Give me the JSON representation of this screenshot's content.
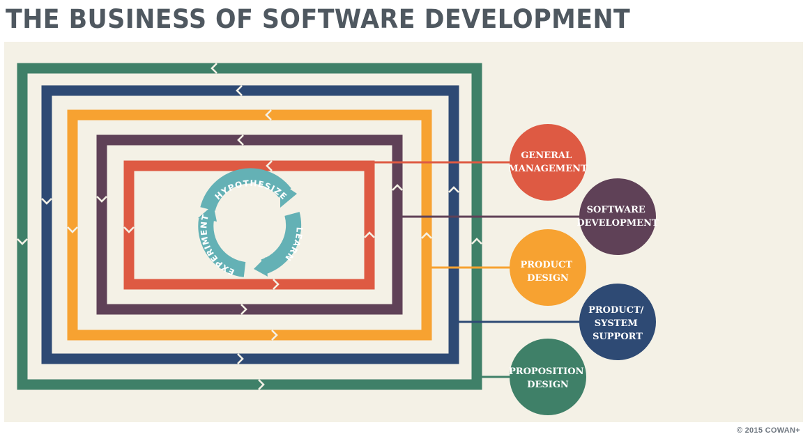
{
  "title": "THE BUSINESS OF SOFTWARE DEVELOPMENT",
  "copyright": "© 2015 COWAN+",
  "colors": {
    "green": "#3f8068",
    "navy": "#2e4a74",
    "orange": "#f7a231",
    "plum": "#5f4157",
    "red": "#de5a43",
    "teal": "#64b1b5",
    "background": "#f4f1e6"
  },
  "cycle": {
    "steps": [
      "HYPOTHESIZE",
      "LEARN",
      "EXPERIMENT"
    ]
  },
  "nodes": [
    {
      "lines": [
        "GENERAL",
        "MANAGEMENT"
      ],
      "color": "red"
    },
    {
      "lines": [
        "SOFTWARE",
        "DEVELOPMENT"
      ],
      "color": "plum"
    },
    {
      "lines": [
        "PRODUCT",
        "DESIGN"
      ],
      "color": "orange"
    },
    {
      "lines": [
        "PRODUCT/",
        "SYSTEM",
        "SUPPORT"
      ],
      "color": "navy"
    },
    {
      "lines": [
        "PROPOSITION",
        "DESIGN"
      ],
      "color": "green"
    }
  ]
}
